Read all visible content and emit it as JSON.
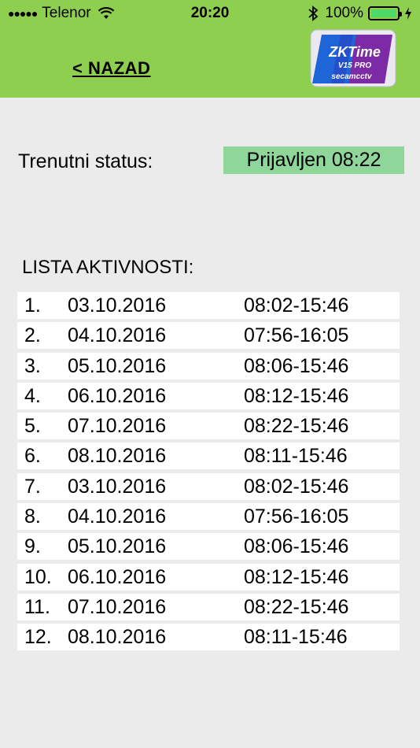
{
  "statusbar": {
    "carrier": "Telenor",
    "time": "20:20",
    "battery": "100%"
  },
  "header": {
    "back_label": "<  NAZAD",
    "logo": {
      "title": "ZKTime",
      "version": "V15 PRO",
      "brand": "secamcctv",
      "colors": [
        "#1e66d8",
        "#7d2aa6"
      ]
    },
    "color": "#8fcf4f"
  },
  "status": {
    "label": "Trenutni status:",
    "value": "Prijavljen 08:22",
    "value_bg": "#8fd69a"
  },
  "activity": {
    "title": "LISTA AKTIVNOSTI:",
    "rows": [
      {
        "num": "1.",
        "date": "03.10.2016",
        "range": "08:02-15:46"
      },
      {
        "num": "2.",
        "date": "04.10.2016",
        "range": "07:56-16:05"
      },
      {
        "num": "3.",
        "date": "05.10.2016",
        "range": "08:06-15:46"
      },
      {
        "num": "4.",
        "date": "06.10.2016",
        "range": "08:12-15:46"
      },
      {
        "num": "5.",
        "date": "07.10.2016",
        "range": "08:22-15:46"
      },
      {
        "num": "6.",
        "date": "08.10.2016",
        "range": "08:11-15:46"
      },
      {
        "num": "7.",
        "date": "03.10.2016",
        "range": "08:02-15:46"
      },
      {
        "num": "8.",
        "date": "04.10.2016",
        "range": "07:56-16:05"
      },
      {
        "num": "9.",
        "date": "05.10.2016",
        "range": "08:06-15:46"
      },
      {
        "num": "10.",
        "date": "06.10.2016",
        "range": "08:12-15:46"
      },
      {
        "num": "11.",
        "date": "07.10.2016",
        "range": "08:22-15:46"
      },
      {
        "num": "12.",
        "date": "08.10.2016",
        "range": "08:11-15:46"
      }
    ]
  }
}
